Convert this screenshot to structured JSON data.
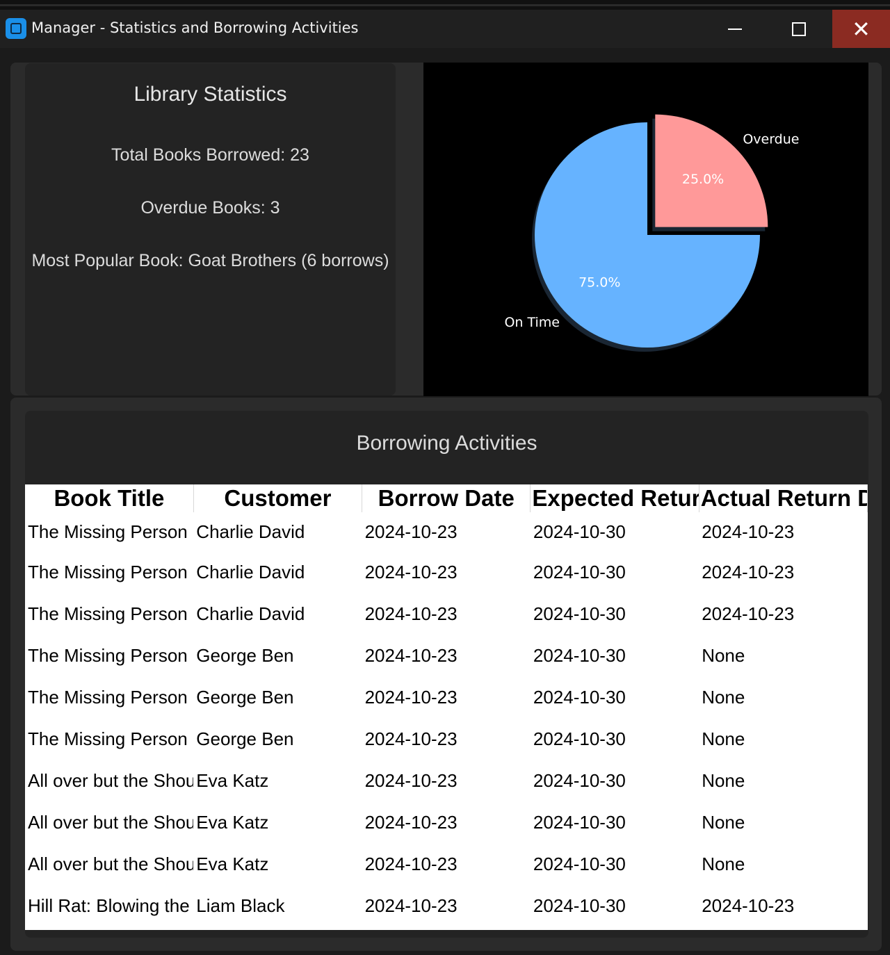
{
  "window": {
    "title": "Manager - Statistics and Borrowing Activities"
  },
  "stats": {
    "title": "Library Statistics",
    "total_books_borrowed": "Total Books Borrowed: 23",
    "overdue_books": "Overdue Books: 3",
    "most_popular": "Most Popular Book: Goat Brothers (6 borrows)"
  },
  "chart_data": {
    "type": "pie",
    "title": "",
    "categories": [
      "Overdue",
      "On Time"
    ],
    "values": [
      25.0,
      75.0
    ],
    "labels": [
      "25.0%",
      "75.0%"
    ],
    "colors": [
      "#ff9999",
      "#66b3ff"
    ],
    "explode": [
      "Overdue"
    ],
    "shadow": true,
    "legend": false
  },
  "activities": {
    "title": "Borrowing Activities",
    "columns": [
      "Book Title",
      "Customer",
      "Borrow Date",
      "Expected Return",
      "Actual Return Date"
    ],
    "rows": [
      [
        "The Missing Person",
        "Charlie David",
        "2024-10-23",
        "2024-10-30",
        "2024-10-23"
      ],
      [
        "The Missing Person",
        "Charlie David",
        "2024-10-23",
        "2024-10-30",
        "2024-10-23"
      ],
      [
        "The Missing Person",
        "Charlie David",
        "2024-10-23",
        "2024-10-30",
        "2024-10-23"
      ],
      [
        "The Missing Person",
        "George Ben",
        "2024-10-23",
        "2024-10-30",
        "None"
      ],
      [
        "The Missing Person",
        "George Ben",
        "2024-10-23",
        "2024-10-30",
        "None"
      ],
      [
        "The Missing Person",
        "George Ben",
        "2024-10-23",
        "2024-10-30",
        "None"
      ],
      [
        "All over but the Shouting",
        "Eva Katz",
        "2024-10-23",
        "2024-10-30",
        "None"
      ],
      [
        "All over but the Shouting",
        "Eva Katz",
        "2024-10-23",
        "2024-10-30",
        "None"
      ],
      [
        "All over but the Shouting",
        "Eva Katz",
        "2024-10-23",
        "2024-10-30",
        "None"
      ],
      [
        "Hill Rat: Blowing the Lid",
        "Liam Black",
        "2024-10-23",
        "2024-10-30",
        "2024-10-23"
      ]
    ]
  }
}
